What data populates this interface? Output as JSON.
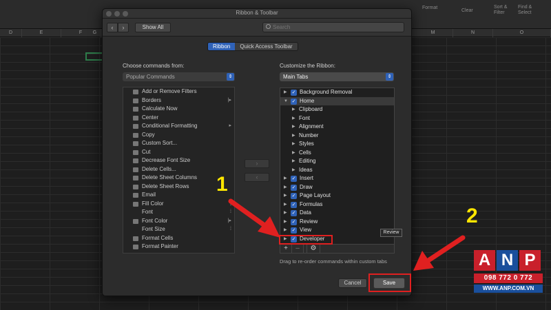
{
  "excel": {
    "columns": [
      "D",
      "E",
      "F",
      "G",
      "",
      "",
      "",
      "M",
      "N",
      "O"
    ],
    "ribbon_labels": [
      "Format",
      "Clear",
      "Sort &",
      "Filter",
      "Find &",
      "Select"
    ]
  },
  "dialog": {
    "title": "Ribbon & Toolbar",
    "toolbar": {
      "back": "‹",
      "forward": "›",
      "show_all": "Show All",
      "search_placeholder": "Search"
    },
    "tabs": [
      {
        "label": "Ribbon",
        "selected": true
      },
      {
        "label": "Quick Access Toolbar",
        "selected": false
      }
    ],
    "left": {
      "label": "Choose commands from:",
      "dropdown": "Popular Commands",
      "commands": [
        {
          "label": "Add or Remove Filters",
          "icon": "filter-icon",
          "sub": ""
        },
        {
          "label": "Borders",
          "icon": "borders-icon",
          "sub": "|▸"
        },
        {
          "label": "Calculate Now",
          "icon": "calculator-icon",
          "sub": ""
        },
        {
          "label": "Center",
          "icon": "align-center-icon",
          "sub": ""
        },
        {
          "label": "Conditional Formatting",
          "icon": "conditional-formatting-icon",
          "sub": "▸"
        },
        {
          "label": "Copy",
          "icon": "copy-icon",
          "sub": ""
        },
        {
          "label": "Custom Sort...",
          "icon": "sort-icon",
          "sub": ""
        },
        {
          "label": "Cut",
          "icon": "scissors-icon",
          "sub": ""
        },
        {
          "label": "Decrease Font Size",
          "icon": "font-decrease-icon",
          "sub": ""
        },
        {
          "label": "Delete Cells...",
          "icon": "delete-cells-icon",
          "sub": ""
        },
        {
          "label": "Delete Sheet Columns",
          "icon": "delete-columns-icon",
          "sub": ""
        },
        {
          "label": "Delete Sheet Rows",
          "icon": "delete-rows-icon",
          "sub": ""
        },
        {
          "label": "Email",
          "icon": "email-icon",
          "sub": ""
        },
        {
          "label": "Fill Color",
          "icon": "fill-color-icon",
          "sub": "|"
        },
        {
          "label": "Font",
          "icon": "",
          "sub": "⁞"
        },
        {
          "label": "Font Color",
          "icon": "font-color-icon",
          "sub": "|▸"
        },
        {
          "label": "Font Size",
          "icon": "",
          "sub": "⁞"
        },
        {
          "label": "Format Cells",
          "icon": "format-cells-icon",
          "sub": ""
        },
        {
          "label": "Format Painter",
          "icon": "format-painter-icon",
          "sub": ""
        }
      ]
    },
    "middle": {
      "add": "›",
      "remove": "‹"
    },
    "right": {
      "label": "Customize the Ribbon:",
      "dropdown": "Main Tabs",
      "tree": [
        {
          "label": "Background Removal",
          "level": 0,
          "expanded": false,
          "checkbox": true
        },
        {
          "label": "Home",
          "level": 0,
          "expanded": true,
          "checkbox": true
        },
        {
          "label": "Clipboard",
          "level": 1,
          "expanded": false,
          "checkbox": false
        },
        {
          "label": "Font",
          "level": 1,
          "expanded": false,
          "checkbox": false
        },
        {
          "label": "Alignment",
          "level": 1,
          "expanded": false,
          "checkbox": false
        },
        {
          "label": "Number",
          "level": 1,
          "expanded": false,
          "checkbox": false
        },
        {
          "label": "Styles",
          "level": 1,
          "expanded": false,
          "checkbox": false
        },
        {
          "label": "Cells",
          "level": 1,
          "expanded": false,
          "checkbox": false
        },
        {
          "label": "Editing",
          "level": 1,
          "expanded": false,
          "checkbox": false
        },
        {
          "label": "Ideas",
          "level": 1,
          "expanded": false,
          "checkbox": false
        },
        {
          "label": "Insert",
          "level": 0,
          "expanded": false,
          "checkbox": true
        },
        {
          "label": "Draw",
          "level": 0,
          "expanded": false,
          "checkbox": true
        },
        {
          "label": "Page Layout",
          "level": 0,
          "expanded": false,
          "checkbox": true
        },
        {
          "label": "Formulas",
          "level": 0,
          "expanded": false,
          "checkbox": true
        },
        {
          "label": "Data",
          "level": 0,
          "expanded": false,
          "checkbox": true
        },
        {
          "label": "Review",
          "level": 0,
          "expanded": false,
          "checkbox": true
        },
        {
          "label": "View",
          "level": 0,
          "expanded": false,
          "checkbox": true
        },
        {
          "label": "Developer",
          "level": 0,
          "expanded": false,
          "checkbox": true
        }
      ],
      "bottom_buttons": {
        "add": "+",
        "remove": "–",
        "settings": "⚙"
      },
      "hint": "Drag to re-order commands within custom tabs",
      "tooltip": "Review"
    },
    "footer": {
      "cancel": "Cancel",
      "save": "Save"
    }
  },
  "annotations": {
    "step1": "1",
    "step2": "2",
    "color": "#e02020",
    "number_color": "#ffe600"
  },
  "watermark": {
    "letters": [
      {
        "char": "A",
        "color": "#c9202b"
      },
      {
        "char": "N",
        "color": "#1a4f9c"
      },
      {
        "char": "P",
        "color": "#c9202b"
      }
    ],
    "phone": "098 772 0 772",
    "url": "WWW.ANP.COM.VN"
  }
}
